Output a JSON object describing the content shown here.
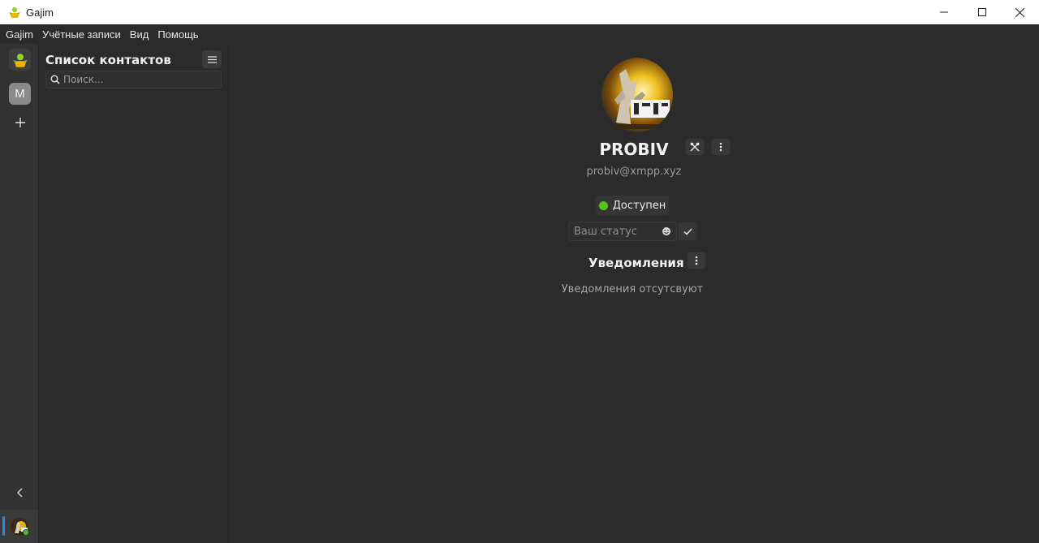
{
  "window": {
    "title": "Gajim"
  },
  "menu": [
    "Gajim",
    "Учётные записи",
    "Вид",
    "Помощь"
  ],
  "rail": {
    "account_letter": "M"
  },
  "contacts": {
    "heading": "Список контактов",
    "search_placeholder": "Поиск..."
  },
  "profile": {
    "name": "PROBIV",
    "jid": "probiv@xmpp.xyz",
    "status_label": "Доступен",
    "status_placeholder": "Ваш статус"
  },
  "notifications": {
    "title": "Уведомления",
    "empty_text": "Уведомления отсутсвуют"
  },
  "colors": {
    "accent": "#3584e4",
    "online": "#57c11e",
    "background": "#2b2b2b"
  }
}
